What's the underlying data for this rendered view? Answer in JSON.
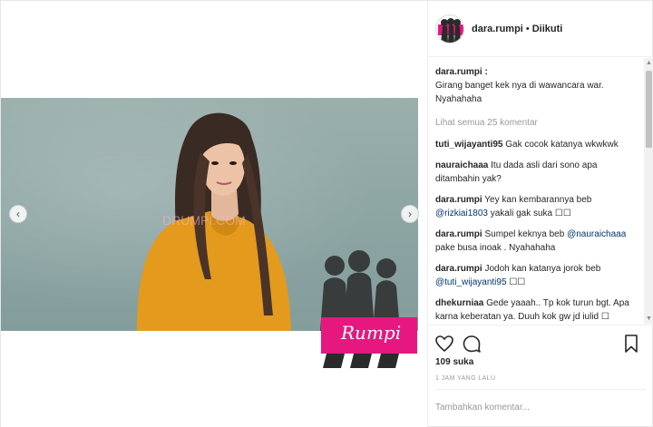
{
  "header": {
    "username": "dara.rumpi",
    "separator": "•",
    "follow_label": "Diikuti"
  },
  "caption": {
    "username": "dara.rumpi :",
    "text": "Girang banget kek nya di wawancara war. Nyahahaha"
  },
  "view_all_comments": "Lihat semua 25 komentar",
  "comments": [
    {
      "username": "tuti_wijayanti95",
      "text": "Gak cocok katanya wkwkwk"
    },
    {
      "username": "nauraichaaa",
      "text": "Itu dada asli dari sono apa ditambahin yak?"
    },
    {
      "username": "dara.rumpi",
      "text": "Yey kan kembarannya beb",
      "mention": "@rizkiai1803",
      "after": "yakali gak suka ☐☐"
    },
    {
      "username": "dara.rumpi",
      "text": "Sumpel keknya beb",
      "mention": "@nauraichaaa",
      "after": "pake busa inoak . Nyahahaha"
    },
    {
      "username": "dara.rumpi",
      "text": "Jodoh kan katanya jorok beb",
      "mention": "@tuti_wijayanti95",
      "after": "☐☐"
    },
    {
      "username": "dhekurniaa",
      "text": "Gede yaaah.. Tp kok turun bgt. Apa karna keberatan ya. Duuh kok gw jd iulid ☐"
    }
  ],
  "likes": "109 suka",
  "time_ago": "1 JAM YANG LALU",
  "add_comment_placeholder": "Tambahkan komentar...",
  "media": {
    "watermark_text": "Rumpi",
    "nav_prev": "‹",
    "nav_next": "›"
  },
  "scroll": {
    "up": "▲",
    "down": "▼"
  },
  "colors": {
    "text": "#262626",
    "muted": "#999999",
    "mention": "#003569",
    "border": "#efefef",
    "brand_pink": "#e6187f",
    "dress_orange": "#e39a1d"
  },
  "icons": {
    "like": "heart-icon",
    "comment": "comment-bubble-icon",
    "save": "bookmark-icon"
  }
}
